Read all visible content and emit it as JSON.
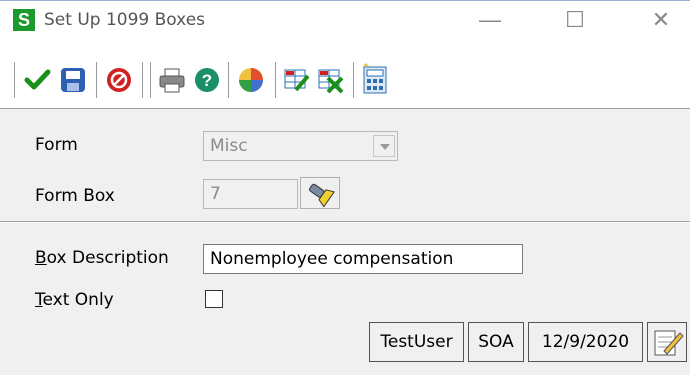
{
  "window": {
    "title": "Set Up 1099 Boxes",
    "app_icon_letter": "S",
    "minimize_glyph": "—",
    "maximize_glyph": "☐",
    "close_glyph": "✕"
  },
  "toolbar": {
    "buttons": [
      {
        "icon": "checkmark-icon",
        "color": "#1a8f1a"
      },
      {
        "icon": "save-icon",
        "color": "#2f5fb0"
      },
      {
        "icon": "delete-icon",
        "color": "#d02020"
      },
      {
        "icon": "print-icon",
        "color": "#666666"
      },
      {
        "icon": "help-icon",
        "color": "#1a8f6a"
      },
      {
        "icon": "windows-icon",
        "color": "#e07020"
      },
      {
        "icon": "grid-edit-icon",
        "color": "#1a8f1a"
      },
      {
        "icon": "grid-delete-icon",
        "color": "#1a8f1a"
      },
      {
        "icon": "calculator-icon",
        "color": "#2f6fb0"
      }
    ]
  },
  "form": {
    "form_label": "Form",
    "form_value": "Misc",
    "form_box_label": "Form Box",
    "form_box_value": "7",
    "box_description_label_first": "B",
    "box_description_label_rest": "ox Description",
    "box_description_value": "Nonemployee compensation",
    "text_only_label_first": "T",
    "text_only_label_rest": "ext Only",
    "text_only_checked": false
  },
  "status": {
    "user": "TestUser",
    "company": "SOA",
    "date": "12/9/2020"
  }
}
